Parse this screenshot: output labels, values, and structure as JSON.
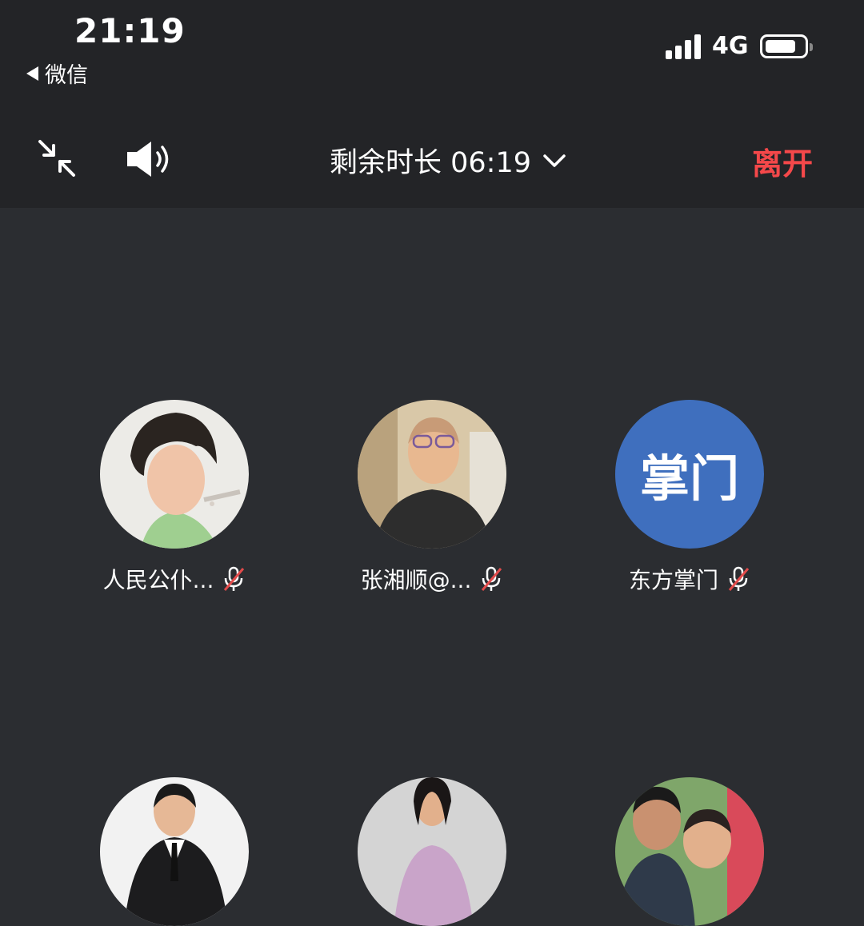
{
  "status_bar": {
    "time": "21:19",
    "back_app": "微信",
    "network": "4G",
    "battery_level": 0.8
  },
  "toolbar": {
    "minimize_icon": "minimize-arrows-icon",
    "speaker_icon": "speaker-icon",
    "remaining_label": "剩余时长 06:19",
    "leave_label": "离开"
  },
  "participants": [
    {
      "name": "人民公仆...",
      "avatar": "photo",
      "muted": true
    },
    {
      "name": "张湘顺@...",
      "avatar": "photo",
      "muted": true
    },
    {
      "name": "东方掌门",
      "avatar_text": "掌门",
      "muted": true
    },
    {
      "name": "",
      "avatar": "photo"
    },
    {
      "name": "",
      "avatar": "photo"
    },
    {
      "name": "",
      "avatar": "photo"
    }
  ],
  "colors": {
    "background": "#2b2d31",
    "topbar": "#232427",
    "leave": "#f5484a",
    "text_avatar": "#3f6fbe",
    "muted_slash": "#e34b4b"
  }
}
